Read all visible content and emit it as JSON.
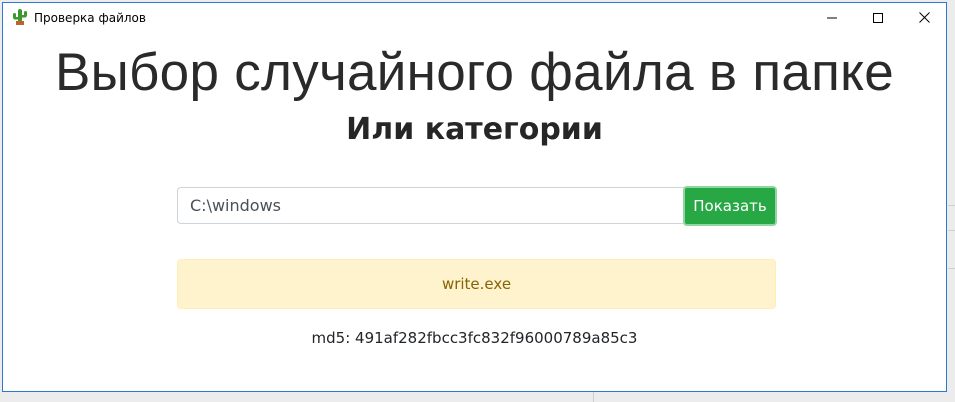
{
  "window": {
    "title": "Проверка файлов",
    "icon": "cactus-icon",
    "accent_color": "#2b79d0",
    "controls": [
      "minimize-icon",
      "maximize-icon",
      "close-icon"
    ]
  },
  "main": {
    "heading": "Выбор случайного файла в папке",
    "subheading": "Или категории",
    "path_input": {
      "value": "C:\\windows",
      "placeholder": ""
    },
    "show_button_label": "Показать",
    "show_button_color": "#28a745",
    "result": {
      "filename": "write.exe",
      "background_color": "#fff3cd",
      "text_color": "#856404"
    },
    "md5_label": "md5: 491af282fbcc3fc832f96000789a85c3"
  }
}
